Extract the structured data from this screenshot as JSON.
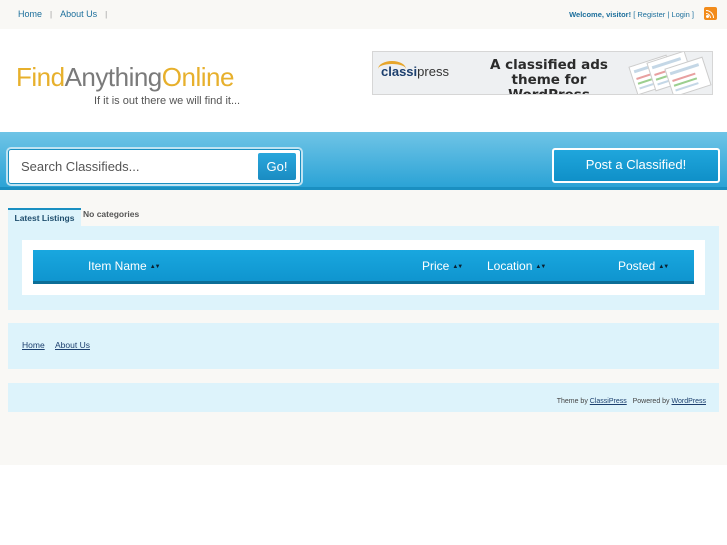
{
  "topnav": {
    "items": [
      "Home",
      "About Us"
    ],
    "separator": "|"
  },
  "welcome": {
    "prefix": "Welcome,",
    "user": "visitor!",
    "register": "Register",
    "login": "Login",
    "bracket_open": "[",
    "bracket_sep": "|",
    "bracket_close": "]"
  },
  "logo": {
    "part1": "Find",
    "part2": "Anything",
    "part3": "Online",
    "tagline": "If it is out there we will find it..."
  },
  "banner": {
    "brand_a": "classi",
    "brand_b": "press",
    "headline": "A classified ads theme for WordPress"
  },
  "search": {
    "placeholder": "Search Classifieds...",
    "button": "Go!"
  },
  "post_button": "Post a Classified!",
  "tabs": {
    "latest": "Latest Listings",
    "no_categories": "No categories"
  },
  "table": {
    "columns": [
      "Item Name",
      "Price",
      "Location",
      "Posted"
    ],
    "sort_glyph": "▲▼"
  },
  "footer_nav": [
    "Home",
    "About Us"
  ],
  "credits": {
    "theme_by": "Theme by",
    "classipress": "ClassiPress",
    "powered_by": "Powered by",
    "wordpress": "WordPress"
  },
  "colors": {
    "accent": "#1a8fc1",
    "panel": "#ddf3fb",
    "logo_gold": "#e7b02c",
    "rss": "#f28b1a"
  },
  "icons": {
    "rss": "rss-feed-icon",
    "sort": "sort-arrows-icon"
  }
}
